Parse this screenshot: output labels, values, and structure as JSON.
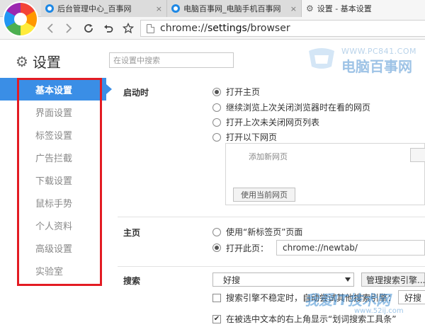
{
  "browser": {
    "tabs": [
      {
        "title": "后台管理中心_百事网",
        "active": false
      },
      {
        "title": "电脑百事网_电脑手机百事网",
        "active": false
      },
      {
        "title": "设置 - 基本设置",
        "active": true
      }
    ],
    "close_glyph": "×",
    "url_scheme": "chrome://",
    "url_host": "settings",
    "url_path": "/browser"
  },
  "settings": {
    "title": "设置",
    "search_placeholder": "在设置中搜索"
  },
  "watermark": {
    "url": "WWW.PC841.COM",
    "name": "电脑百事网",
    "bottom_name": "我爱IT技术网",
    "bottom_url": "www.52ij.com"
  },
  "sidebar": {
    "items": [
      {
        "label": "基本设置",
        "active": true
      },
      {
        "label": "界面设置"
      },
      {
        "label": "标签设置"
      },
      {
        "label": "广告拦截"
      },
      {
        "label": "下载设置"
      },
      {
        "label": "鼠标手势"
      },
      {
        "label": "个人资料"
      },
      {
        "label": "高级设置"
      },
      {
        "label": "实验室"
      }
    ]
  },
  "startup": {
    "label": "启动时",
    "options": [
      {
        "label": "打开主页",
        "checked": true
      },
      {
        "label": "继续浏览上次关闭浏览器时在看的网页",
        "checked": false
      },
      {
        "label": "打开上次未关闭网页列表",
        "checked": false
      },
      {
        "label": "打开以下网页",
        "checked": false
      }
    ],
    "add_page_placeholder": "添加新网页",
    "use_current_label": "使用当前网页"
  },
  "homepage": {
    "label": "主页",
    "option_newtab": "使用“新标签页”页面",
    "option_open_page": "打开此页：",
    "url_value": "chrome://newtab/"
  },
  "search": {
    "label": "搜索",
    "engine_selected": "好搜",
    "manage_label": "管理搜索引擎...",
    "fallback_label": "搜索引擎不稳定时，自动尝试其他搜索引擎：",
    "fallback_engine": "好搜",
    "fallback_checked": false,
    "toolbar_label": "在被选中文本的右上角显示“划词搜索工具条”",
    "toolbar_checked": true
  }
}
